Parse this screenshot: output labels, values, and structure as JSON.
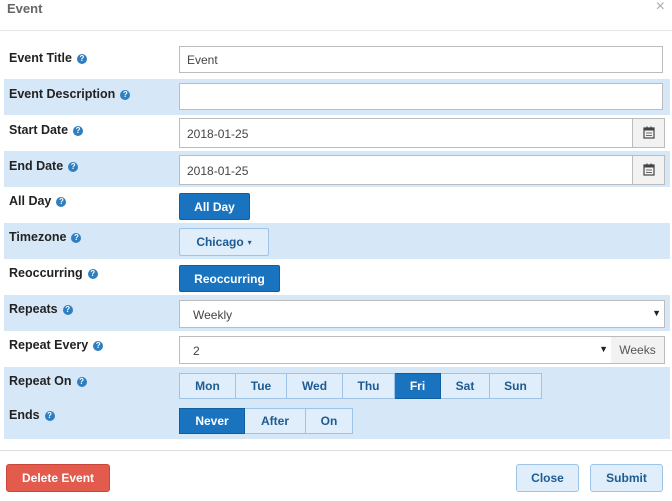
{
  "window": {
    "title": "Event",
    "close_glyph": "×"
  },
  "fields": {
    "event_title": {
      "label": "Event Title",
      "value": "Event"
    },
    "event_description": {
      "label": "Event Description",
      "value": ""
    },
    "start_date": {
      "label": "Start Date",
      "value": "2018-01-25"
    },
    "end_date": {
      "label": "End Date",
      "value": "2018-01-25"
    },
    "all_day": {
      "label": "All Day",
      "button": "All Day"
    },
    "timezone": {
      "label": "Timezone",
      "button": "Chicago"
    },
    "reoccurring": {
      "label": "Reoccurring",
      "button": "Reoccurring"
    },
    "repeats": {
      "label": "Repeats",
      "value": "Weekly"
    },
    "repeat_every": {
      "label": "Repeat Every",
      "value": "2",
      "unit": "Weeks"
    },
    "repeat_on": {
      "label": "Repeat On",
      "days": [
        "Mon",
        "Tue",
        "Wed",
        "Thu",
        "Fri",
        "Sat",
        "Sun"
      ],
      "selected": "Fri"
    },
    "ends": {
      "label": "Ends",
      "options": [
        "Never",
        "After",
        "On"
      ],
      "selected": "Never"
    }
  },
  "footer": {
    "delete_label": "Delete Event",
    "close_label": "Close",
    "submit_label": "Submit"
  },
  "icons": {
    "help": "help-icon",
    "calendar": "calendar-icon",
    "caret": "caret-down-icon"
  },
  "colors": {
    "accent": "#1a73be",
    "row_highlight": "#d6e8f8",
    "danger": "#e25b4c"
  }
}
